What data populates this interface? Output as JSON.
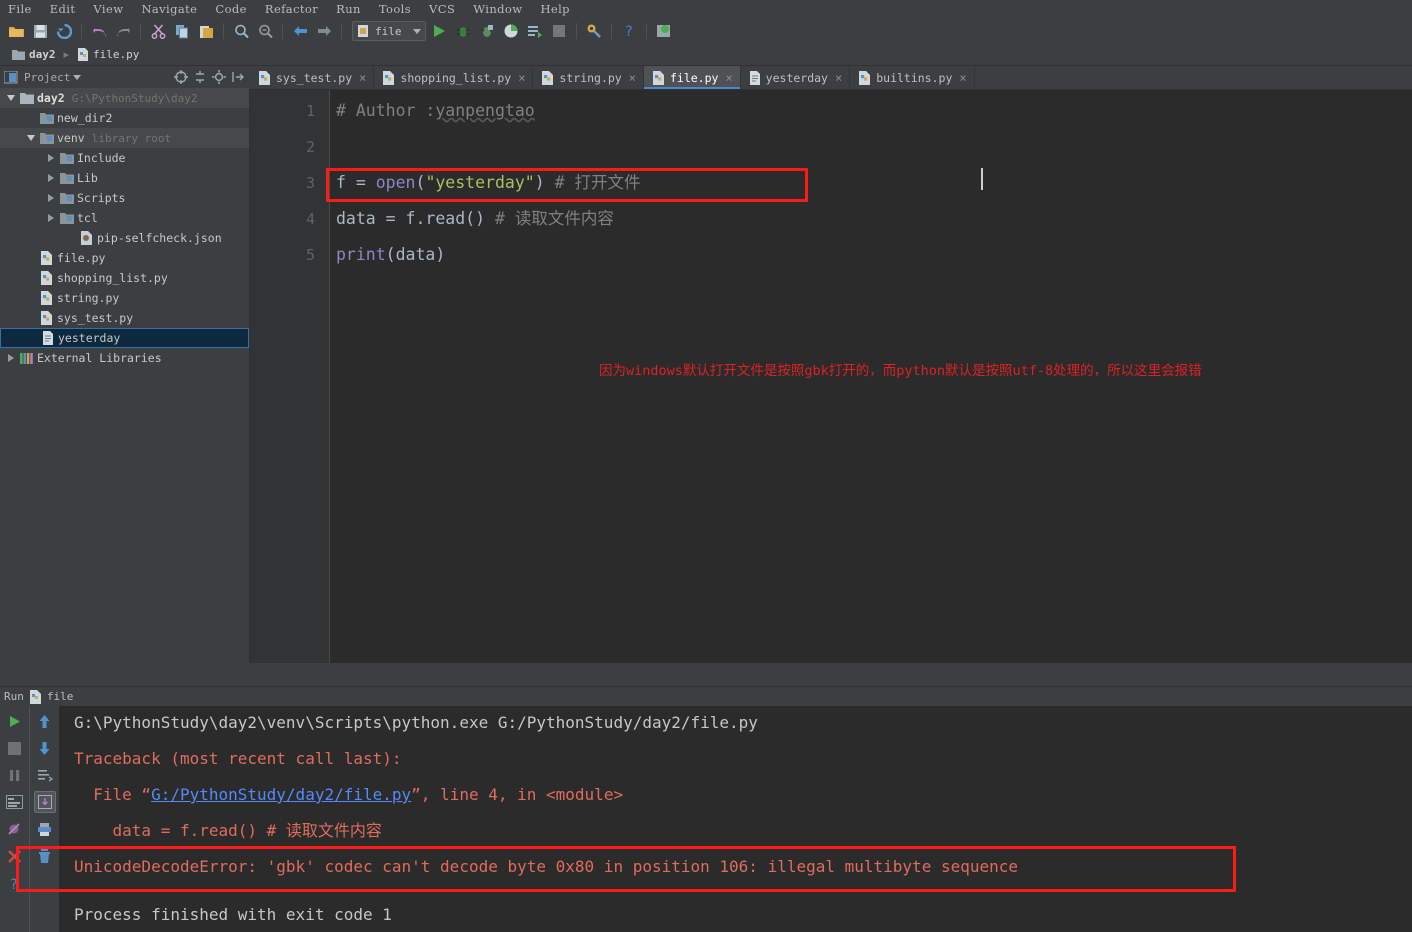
{
  "menubar": {
    "items": [
      {
        "label": "File"
      },
      {
        "label": "Edit"
      },
      {
        "label": "View"
      },
      {
        "label": "Navigate"
      },
      {
        "label": "Code"
      },
      {
        "label": "Refactor"
      },
      {
        "label": "Run"
      },
      {
        "label": "Tools"
      },
      {
        "label": "VCS"
      },
      {
        "label": "Window"
      },
      {
        "label": "Help"
      }
    ]
  },
  "toolbar": {
    "icons": [
      {
        "name": "open-folder-icon"
      },
      {
        "name": "save-all-icon"
      },
      {
        "name": "sync-icon"
      },
      {
        "name": "undo-icon"
      },
      {
        "name": "redo-icon"
      },
      {
        "name": "cut-icon"
      },
      {
        "name": "copy-icon"
      },
      {
        "name": "paste-icon"
      },
      {
        "name": "find-icon"
      },
      {
        "name": "replace-icon"
      },
      {
        "name": "back-icon"
      },
      {
        "name": "forward-icon"
      }
    ],
    "run_config": "file",
    "run_label": "Run",
    "debug_label": "Debug",
    "coverage_label": "Run with Coverage",
    "profile_label": "Profile",
    "attach_label": "Attach",
    "stop_label": "Stop",
    "settings_label": "Settings",
    "help_label": "Help",
    "updates_label": "Updates"
  },
  "breadcrumb": {
    "items": [
      {
        "label": "day2",
        "icon": "folder-icon"
      },
      {
        "label": "file.py",
        "icon": "python-file-icon"
      }
    ]
  },
  "project_panel": {
    "title": "Project",
    "tree": [
      {
        "indent": 0,
        "arrow": "down",
        "icon": "folder-icon",
        "label": "day2",
        "sub": "G:\\PythonStudy\\day2",
        "bold": true,
        "alt": true,
        "selected": false
      },
      {
        "indent": 1,
        "arrow": "none",
        "icon": "folder-blue-icon",
        "label": "new_dir2",
        "sub": "",
        "bold": false,
        "alt": false,
        "selected": false
      },
      {
        "indent": 1,
        "arrow": "down",
        "icon": "folder-blue-icon",
        "label": "venv",
        "sub": "library root",
        "bold": false,
        "alt": true,
        "selected": false
      },
      {
        "indent": 2,
        "arrow": "right",
        "icon": "folder-blue-icon",
        "label": "Include",
        "sub": "",
        "bold": false,
        "alt": false,
        "selected": false
      },
      {
        "indent": 2,
        "arrow": "right",
        "icon": "folder-blue-icon",
        "label": "Lib",
        "sub": "",
        "bold": false,
        "alt": false,
        "selected": false
      },
      {
        "indent": 2,
        "arrow": "right",
        "icon": "folder-blue-icon",
        "label": "Scripts",
        "sub": "",
        "bold": false,
        "alt": false,
        "selected": false
      },
      {
        "indent": 2,
        "arrow": "right",
        "icon": "folder-blue-icon",
        "label": "tcl",
        "sub": "",
        "bold": false,
        "alt": false,
        "selected": false
      },
      {
        "indent": 3,
        "arrow": "none",
        "icon": "json-file-icon",
        "label": "pip-selfcheck.json",
        "sub": "",
        "bold": false,
        "alt": false,
        "selected": false
      },
      {
        "indent": 1,
        "arrow": "none",
        "icon": "python-file-icon",
        "label": "file.py",
        "sub": "",
        "bold": false,
        "alt": false,
        "selected": false
      },
      {
        "indent": 1,
        "arrow": "none",
        "icon": "python-file-icon",
        "label": "shopping_list.py",
        "sub": "",
        "bold": false,
        "alt": false,
        "selected": false
      },
      {
        "indent": 1,
        "arrow": "none",
        "icon": "python-file-icon",
        "label": "string.py",
        "sub": "",
        "bold": false,
        "alt": false,
        "selected": false
      },
      {
        "indent": 1,
        "arrow": "none",
        "icon": "python-file-icon",
        "label": "sys_test.py",
        "sub": "",
        "bold": false,
        "alt": false,
        "selected": false
      },
      {
        "indent": 1,
        "arrow": "none",
        "icon": "text-file-icon",
        "label": "yesterday",
        "sub": "",
        "bold": false,
        "alt": false,
        "selected": true
      },
      {
        "indent": 0,
        "arrow": "right",
        "icon": "libraries-icon",
        "label": "External Libraries",
        "sub": "",
        "bold": false,
        "alt": false,
        "selected": false
      }
    ]
  },
  "editor": {
    "tabs": [
      {
        "label": "sys_test.py",
        "icon": "python-file-icon",
        "active": false
      },
      {
        "label": "shopping_list.py",
        "icon": "python-file-icon",
        "active": false
      },
      {
        "label": "string.py",
        "icon": "python-file-icon",
        "active": false
      },
      {
        "label": "file.py",
        "icon": "python-file-icon",
        "active": true
      },
      {
        "label": "yesterday",
        "icon": "text-file-icon",
        "active": false
      },
      {
        "label": "builtins.py",
        "icon": "python-file-icon",
        "active": false
      }
    ],
    "line_numbers": [
      "1",
      "2",
      "3",
      "4",
      "5"
    ],
    "lines": [
      {
        "num": "1",
        "segments": [
          {
            "text": "# Author :",
            "cls": "c-comment"
          },
          {
            "text": "yanpengtao",
            "cls": "c-comment squig"
          }
        ]
      },
      {
        "num": "2",
        "segments": []
      },
      {
        "num": "3",
        "segments": [
          {
            "text": "f ",
            "cls": "c-fn"
          },
          {
            "text": "= ",
            "cls": "c-punct"
          },
          {
            "text": "open",
            "cls": "c-builtin"
          },
          {
            "text": "(",
            "cls": "c-punct"
          },
          {
            "text": "\"yesterday\"",
            "cls": "c-str"
          },
          {
            "text": ") ",
            "cls": "c-punct"
          },
          {
            "text": "# 打开文件",
            "cls": "c-comment"
          }
        ]
      },
      {
        "num": "4",
        "segments": [
          {
            "text": "data ",
            "cls": "c-fn"
          },
          {
            "text": "= ",
            "cls": "c-punct"
          },
          {
            "text": "f.read() ",
            "cls": "c-fn"
          },
          {
            "text": "# 读取文件内容",
            "cls": "c-comment"
          }
        ]
      },
      {
        "num": "5",
        "segments": [
          {
            "text": "print",
            "cls": "c-builtin"
          },
          {
            "text": "(data)",
            "cls": "c-punct"
          }
        ]
      }
    ],
    "highlight_line": "3",
    "highlight_color": "#ff1a1a",
    "annotation": "因为windows默认打开文件是按照gbk打开的，而python默认是按照utf-8处理的，所以这里会报错",
    "annotation_color": "#dd2222"
  },
  "run_panel": {
    "tab_label": "Run",
    "tab_file": "file",
    "left_buttons": [
      {
        "name": "rerun-button",
        "label": "Rerun"
      },
      {
        "name": "stop-button",
        "label": "Stop"
      },
      {
        "name": "pause-button",
        "label": "Pause Output"
      },
      {
        "name": "console-button",
        "label": "Console"
      },
      {
        "name": "mute-button",
        "label": "Mute Breakpoints"
      },
      {
        "name": "close-button",
        "label": "Close"
      },
      {
        "name": "help-button",
        "label": "Help"
      }
    ],
    "right_buttons": [
      {
        "name": "scroll-up-button",
        "label": "Up the Stack Trace"
      },
      {
        "name": "scroll-down-button",
        "label": "Down the Stack Trace"
      },
      {
        "name": "soft-wrap-button",
        "label": "Use Soft Wraps"
      },
      {
        "name": "scroll-end-button",
        "label": "Scroll to End"
      },
      {
        "name": "print-button",
        "label": "Print"
      },
      {
        "name": "clear-all-button",
        "label": "Clear All"
      }
    ],
    "output": [
      {
        "segments": [
          {
            "text": "G:\\PythonStudy\\day2\\venv\\Scripts\\python.exe G:/PythonStudy/day2/file.py",
            "cls": "o-norm"
          }
        ]
      },
      {
        "segments": [
          {
            "text": "Traceback (most recent call last):",
            "cls": "o-err"
          }
        ]
      },
      {
        "segments": [
          {
            "text": "  File “",
            "cls": "o-err"
          },
          {
            "text": "G:/PythonStudy/day2/file.py",
            "cls": "o-link"
          },
          {
            "text": "”, line 4, in <module>",
            "cls": "o-err"
          }
        ]
      },
      {
        "segments": [
          {
            "text": "    data = f.read() # 读取文件内容",
            "cls": "o-err"
          }
        ]
      },
      {
        "segments": [
          {
            "text": "UnicodeDecodeError: 'gbk' codec can't decode byte 0x80 in position 106: illegal multibyte sequence",
            "cls": "o-err"
          }
        ]
      }
    ],
    "error_highlight_line": "UnicodeDecodeError: 'gbk' codec can't decode byte 0x80 in position 106: illegal multibyte sequence",
    "error_highlight_color": "#ff1a1a",
    "exit_line": "Process finished with exit code 1"
  }
}
